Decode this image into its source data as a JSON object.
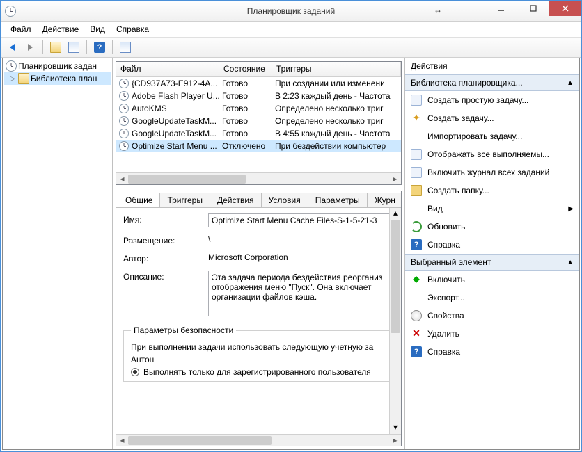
{
  "window": {
    "title": "Планировщик заданий"
  },
  "menu": {
    "file": "Файл",
    "action": "Действие",
    "view": "Вид",
    "help": "Справка"
  },
  "tree": {
    "root": "Планировщик задан",
    "library": "Библиотека план"
  },
  "tasklist": {
    "headers": {
      "file": "Файл",
      "state": "Состояние",
      "triggers": "Триггеры"
    },
    "rows": [
      {
        "name": "{CD937A73-E912-4A...",
        "state": "Готово",
        "trigger": "При создании или изменени"
      },
      {
        "name": "Adobe Flash Player U...",
        "state": "Готово",
        "trigger": "В 2:23 каждый день - Частота"
      },
      {
        "name": "AutoKMS",
        "state": "Готово",
        "trigger": "Определено несколько триг"
      },
      {
        "name": "GoogleUpdateTaskM...",
        "state": "Готово",
        "trigger": "Определено несколько триг"
      },
      {
        "name": "GoogleUpdateTaskM...",
        "state": "Готово",
        "trigger": "В 4:55 каждый день - Частота"
      },
      {
        "name": "Optimize Start Menu ...",
        "state": "Отключено",
        "trigger": "При бездействии компьютер"
      }
    ],
    "selected_index": 5
  },
  "details": {
    "tabs": {
      "general": "Общие",
      "triggers": "Триггеры",
      "actions": "Действия",
      "conditions": "Условия",
      "settings": "Параметры",
      "history": "Журн"
    },
    "labels": {
      "name": "Имя:",
      "location": "Размещение:",
      "author": "Автор:",
      "description": "Описание:"
    },
    "values": {
      "name": "Optimize Start Menu Cache Files-S-1-5-21-3",
      "location": "\\",
      "author": "Microsoft Corporation",
      "description": "Эта задача периода бездействия реорганиз отображения меню \"Пуск\". Она включает организации файлов кэша."
    },
    "security": {
      "legend": "Параметры безопасности",
      "account_label": "При выполнении задачи использовать следующую учетную за",
      "account": "Антон",
      "radio1": "Выполнять только для зарегистрированного пользователя"
    }
  },
  "actions": {
    "title": "Действия",
    "group1": {
      "title": "Библиотека планировщика...",
      "items": [
        {
          "label": "Создать простую задачу...",
          "icon": "generic"
        },
        {
          "label": "Создать задачу...",
          "icon": "star"
        },
        {
          "label": "Импортировать задачу...",
          "icon": ""
        },
        {
          "label": "Отображать все выполняемы...",
          "icon": "generic"
        },
        {
          "label": "Включить журнал всех заданий",
          "icon": "generic"
        },
        {
          "label": "Создать папку...",
          "icon": "folder"
        },
        {
          "label": "Вид",
          "icon": "",
          "arrow": true
        },
        {
          "label": "Обновить",
          "icon": "refresh"
        },
        {
          "label": "Справка",
          "icon": "help"
        }
      ]
    },
    "group2": {
      "title": "Выбранный элемент",
      "items": [
        {
          "label": "Включить",
          "icon": "enable"
        },
        {
          "label": "Экспорт...",
          "icon": ""
        },
        {
          "label": "Свойства",
          "icon": "prop"
        },
        {
          "label": "Удалить",
          "icon": "delete"
        },
        {
          "label": "Справка",
          "icon": "help"
        }
      ]
    }
  }
}
